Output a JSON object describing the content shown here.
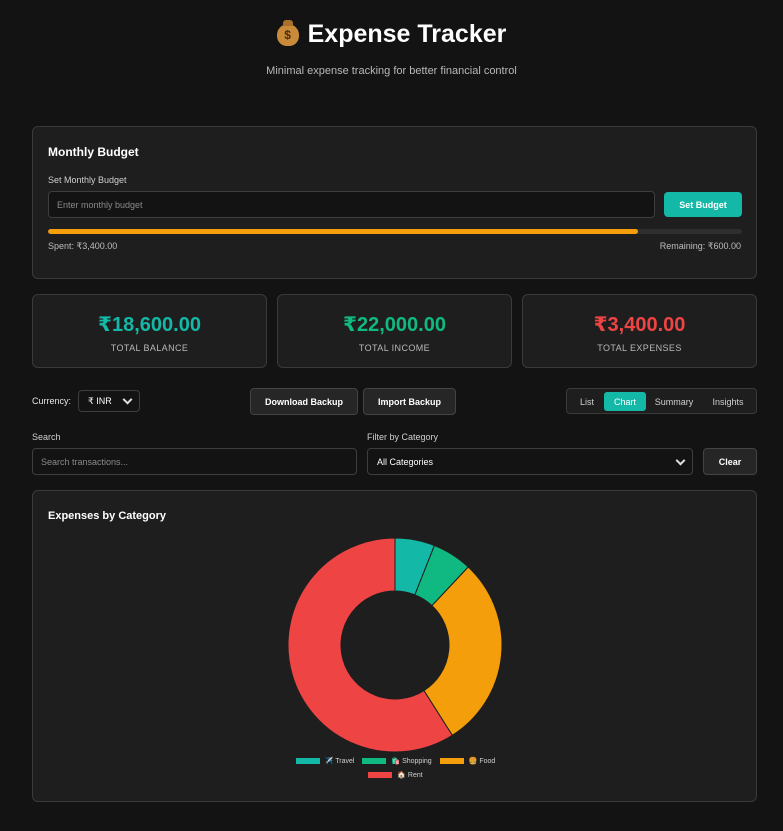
{
  "header": {
    "icon": "money-bag-icon",
    "title": "Expense Tracker",
    "subtitle": "Minimal expense tracking for better financial control"
  },
  "budget": {
    "heading": "Monthly Budget",
    "field_label": "Set Monthly Budget",
    "placeholder": "Enter monthly budget",
    "button": "Set Budget",
    "progress_fraction": 0.85,
    "spent": "Spent: ₹3,400.00",
    "remaining": "Remaining: ₹600.00"
  },
  "stats": {
    "balance": {
      "value": "₹18,600.00",
      "label": "TOTAL BALANCE",
      "color": "#14b8a6"
    },
    "income": {
      "value": "₹22,000.00",
      "label": "TOTAL INCOME",
      "color": "#10b981"
    },
    "expenses": {
      "value": "₹3,400.00",
      "label": "TOTAL EXPENSES",
      "color": "#ef4444"
    }
  },
  "controls": {
    "currency_label": "Currency:",
    "currency_value": "₹ INR",
    "download_backup": "Download Backup",
    "import_backup": "Import Backup",
    "tabs": [
      "List",
      "Chart",
      "Summary",
      "Insights"
    ],
    "active_tab": "Chart",
    "search_label": "Search",
    "search_placeholder": "Search transactions...",
    "filter_label": "Filter by Category",
    "filter_value": "All Categories",
    "clear": "Clear"
  },
  "chart_data": {
    "type": "pie",
    "title": "Expenses by Category",
    "categories": [
      "✈️ Travel",
      "🛍️ Shopping",
      "🍔 Food",
      "🏠 Rent"
    ],
    "values": [
      6,
      6,
      29,
      59
    ],
    "colors": [
      "#14b8a6",
      "#10b981",
      "#f59e0b",
      "#ef4444"
    ],
    "legend_placement": "bottom"
  },
  "colors": {
    "accent": "#14b8a6",
    "budget_bar": "#f59e0b",
    "background": "#131313",
    "card": "#1e1e1e"
  }
}
